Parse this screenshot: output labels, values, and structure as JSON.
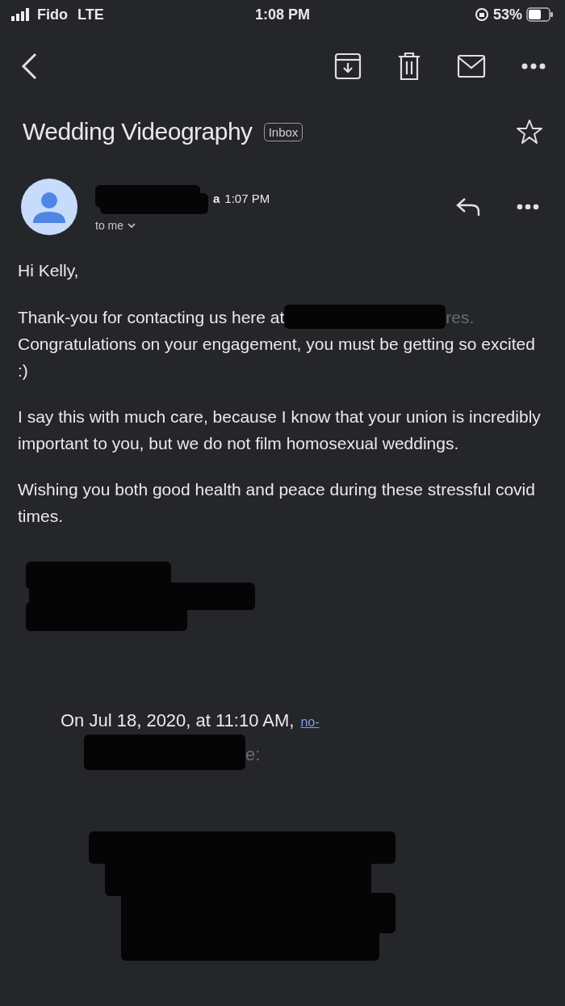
{
  "status_bar": {
    "carrier": "Fido",
    "network": "LTE",
    "time": "1:08 PM",
    "battery": "53%"
  },
  "subject": {
    "title": "Wedding Videography",
    "label": "Inbox",
    "starred": false
  },
  "message": {
    "sender_suffix": "a",
    "time": "1:07 PM",
    "recipient": "to me",
    "greeting": "Hi Kelly,",
    "intro_start": "Thank-you for contacting us here at",
    "intro_end": "res.",
    "paragraphs": [
      "Congratulations on your engagement, you must be getting so excited :)",
      "I say this with much care, because I know that your union is incredibly important to you, but we do not film homosexual weddings.",
      "Wishing you both good health and peace during these stressful covid times."
    ],
    "quote_header": "On Jul 18, 2020, at 11:10 AM,",
    "quote_link": "no-",
    "quote_suffix": "e:"
  }
}
